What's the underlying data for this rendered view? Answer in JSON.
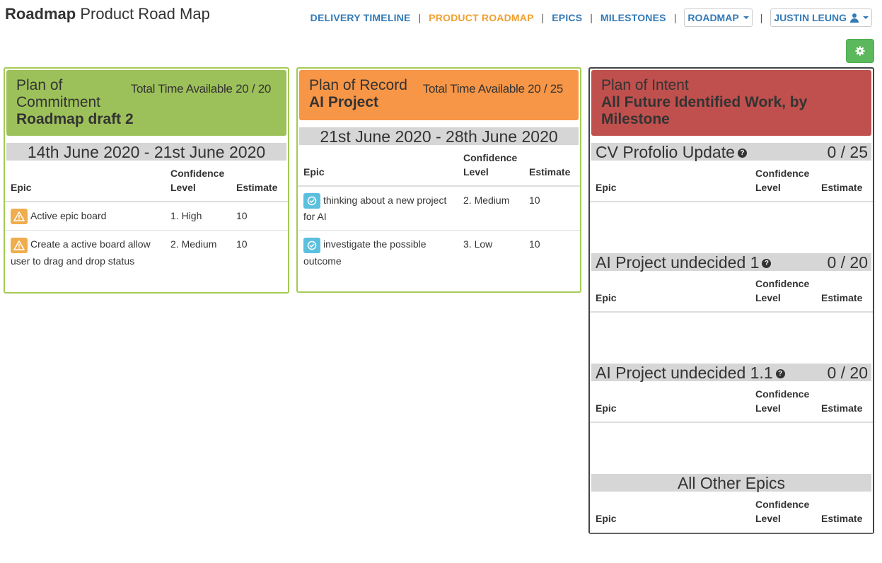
{
  "header": {
    "brand_bold": "Roadmap",
    "brand_rest": "Product Road Map",
    "nav": {
      "delivery_timeline": "DELIVERY TIMELINE",
      "product_roadmap": "PRODUCT ROADMAP",
      "epics": "EPICS",
      "milestones": "MILESTONES",
      "roadmap_dropdown": "ROADMAP",
      "user_dropdown": "JUSTIN LEUNG",
      "separator": "|"
    },
    "colors": {
      "link": "#337ab7",
      "active": "#f0a030",
      "gear_button": "#5cb85c"
    },
    "settings_icon": "gear-icon"
  },
  "table_headers": {
    "epic": "Epic",
    "confidence": "Confidence Level",
    "estimate": "Estimate"
  },
  "columns": {
    "commitment": {
      "type": "Plan of Commitment",
      "name": "Roadmap draft 2",
      "time_available": "Total Time Available 20 / 20",
      "color": "#9dc15a",
      "section_title": "14th June 2020 - 21st June 2020",
      "rows": [
        {
          "icon": "warning-icon",
          "epic": "Active epic board",
          "confidence": "1. High",
          "estimate": "10"
        },
        {
          "icon": "warning-icon",
          "epic": "Create a active board allow user to drag and drop status",
          "confidence": "2. Medium",
          "estimate": "10"
        }
      ]
    },
    "record": {
      "type": "Plan of Record",
      "name": "AI Project",
      "time_available": "Total Time Available 20 / 25",
      "color": "#f79646",
      "section_title": "21st June 2020 - 28th June 2020",
      "rows": [
        {
          "icon": "check-circle-icon",
          "epic": "thinking about a new project for AI",
          "confidence": "2. Medium",
          "estimate": "10"
        },
        {
          "icon": "check-circle-icon",
          "epic": "investigate the possible outcome",
          "confidence": "3. Low",
          "estimate": "10"
        }
      ]
    },
    "intent": {
      "type": "Plan of Intent",
      "name": "All Future Identified Work, by Milestone",
      "color": "#c0504d",
      "sections": [
        {
          "title": "CV Profolio Update",
          "count": "0 / 25"
        },
        {
          "title": "AI Project undecided 1",
          "count": "0 / 20"
        },
        {
          "title": "AI Project undecided 1.1",
          "count": "0 / 20"
        },
        {
          "title": "All Other Epics"
        }
      ]
    }
  }
}
